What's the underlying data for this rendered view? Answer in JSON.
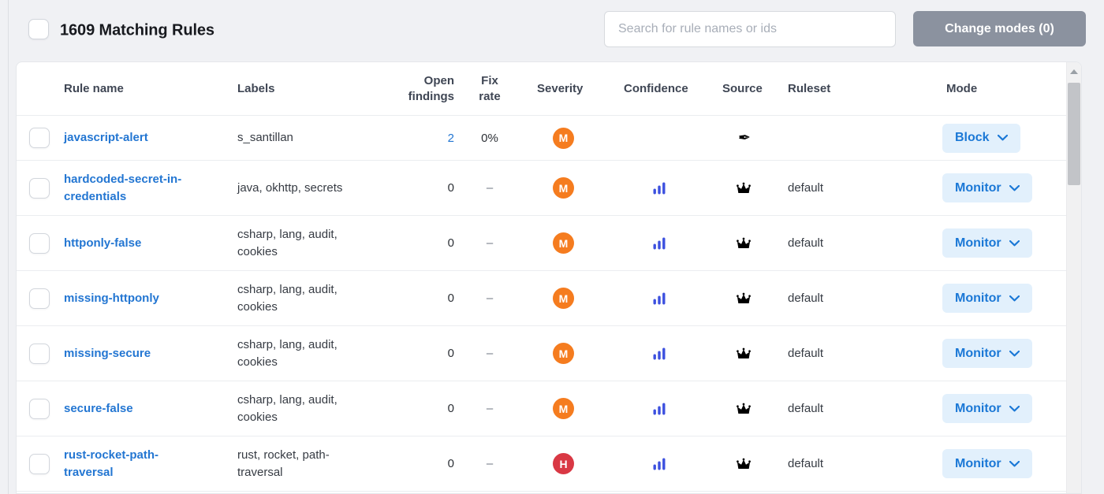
{
  "header": {
    "title": "1609 Matching Rules",
    "search_placeholder": "Search for rule names or ids",
    "change_modes_label": "Change modes (0)"
  },
  "table": {
    "columns": [
      "Rule name",
      "Labels",
      "Open findings",
      "Fix rate",
      "Severity",
      "Confidence",
      "Source",
      "Ruleset",
      "Mode"
    ],
    "rows": [
      {
        "rule_name": "javascript-alert",
        "labels": "s_santillan",
        "open_findings": "2",
        "open_findings_link": true,
        "fix_rate": "0%",
        "severity": "M",
        "confidence": false,
        "source_icon": "pen-icon",
        "ruleset": "",
        "mode": "Block"
      },
      {
        "rule_name": "hardcoded-secret-in-credentials",
        "labels": "java, okhttp, secrets",
        "open_findings": "0",
        "open_findings_link": false,
        "fix_rate": "–",
        "severity": "M",
        "confidence": true,
        "source_icon": "crown-icon",
        "ruleset": "default",
        "mode": "Monitor"
      },
      {
        "rule_name": "httponly-false",
        "labels": "csharp, lang, audit, cookies",
        "open_findings": "0",
        "open_findings_link": false,
        "fix_rate": "–",
        "severity": "M",
        "confidence": true,
        "source_icon": "crown-icon",
        "ruleset": "default",
        "mode": "Monitor"
      },
      {
        "rule_name": "missing-httponly",
        "labels": "csharp, lang, audit, cookies",
        "open_findings": "0",
        "open_findings_link": false,
        "fix_rate": "–",
        "severity": "M",
        "confidence": true,
        "source_icon": "crown-icon",
        "ruleset": "default",
        "mode": "Monitor"
      },
      {
        "rule_name": "missing-secure",
        "labels": "csharp, lang, audit, cookies",
        "open_findings": "0",
        "open_findings_link": false,
        "fix_rate": "–",
        "severity": "M",
        "confidence": true,
        "source_icon": "crown-icon",
        "ruleset": "default",
        "mode": "Monitor"
      },
      {
        "rule_name": "secure-false",
        "labels": "csharp, lang, audit, cookies",
        "open_findings": "0",
        "open_findings_link": false,
        "fix_rate": "–",
        "severity": "M",
        "confidence": true,
        "source_icon": "crown-icon",
        "ruleset": "default",
        "mode": "Monitor"
      },
      {
        "rule_name": "rust-rocket-path-traversal",
        "labels": "rust, rocket, path-traversal",
        "open_findings": "0",
        "open_findings_link": false,
        "fix_rate": "–",
        "severity": "H",
        "confidence": true,
        "source_icon": "crown-icon",
        "ruleset": "default",
        "mode": "Monitor"
      }
    ]
  },
  "colors": {
    "link_blue": "#2376d2",
    "severity_M": "#f57c1f",
    "severity_H": "#d93844",
    "confidence_bars": "#3c50df",
    "mode_button_bg": "#e2f0fc",
    "mode_button_text": "#1b78d6",
    "change_modes_bg": "#8b929f"
  }
}
